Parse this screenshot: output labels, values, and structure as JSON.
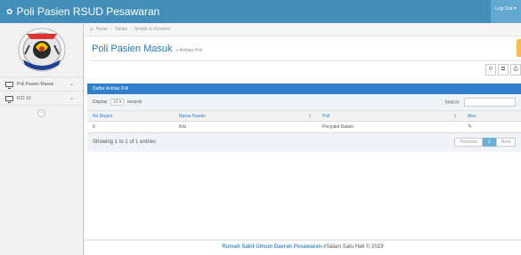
{
  "app": {
    "brand": "Poli Pasien RSUD Pesawaran",
    "logout_label": "Log Out"
  },
  "sidebar": {
    "logo_alt": "RSUD Pesawaran logo",
    "items": [
      {
        "label": "Poli Pasien Masuk",
        "icon": "desktop-icon"
      },
      {
        "label": "ICD 10",
        "icon": "desktop-icon"
      }
    ],
    "collapse_icon": "double-chevron-icon"
  },
  "breadcrumb": {
    "home": "Home",
    "items": [
      "Tables",
      "Simple & Dynamic"
    ]
  },
  "page": {
    "title": "Poli Pasien Masuk",
    "subtitle": "» Antrian Poli"
  },
  "toolbar": {
    "search_icon": "search-icon",
    "copy_icon": "copy-icon",
    "print_icon": "print-icon"
  },
  "table": {
    "title": "Daftar Antrian Poli",
    "display_label": "Display",
    "display_value": "10",
    "records_label": "records",
    "search_label": "Search:",
    "columns": [
      "No Regist",
      "Nama Pasien",
      "Poli",
      "Aksi"
    ],
    "rows": [
      {
        "no": "6",
        "nama": "Kiki",
        "poli": "Penyakit Dalam"
      }
    ],
    "info": "Showing 1 to 1 of 1 entries",
    "pagination": {
      "prev": "Previous",
      "current": "1",
      "next": "Next"
    }
  },
  "footer": {
    "org": "Rumah Sakit Umum Daerah Pesawaran",
    "motto": "#Salam Satu Hati © 2019"
  },
  "colors": {
    "topbar": "#438eb9",
    "title": "#2679b5",
    "table_header": "#307ecc"
  }
}
